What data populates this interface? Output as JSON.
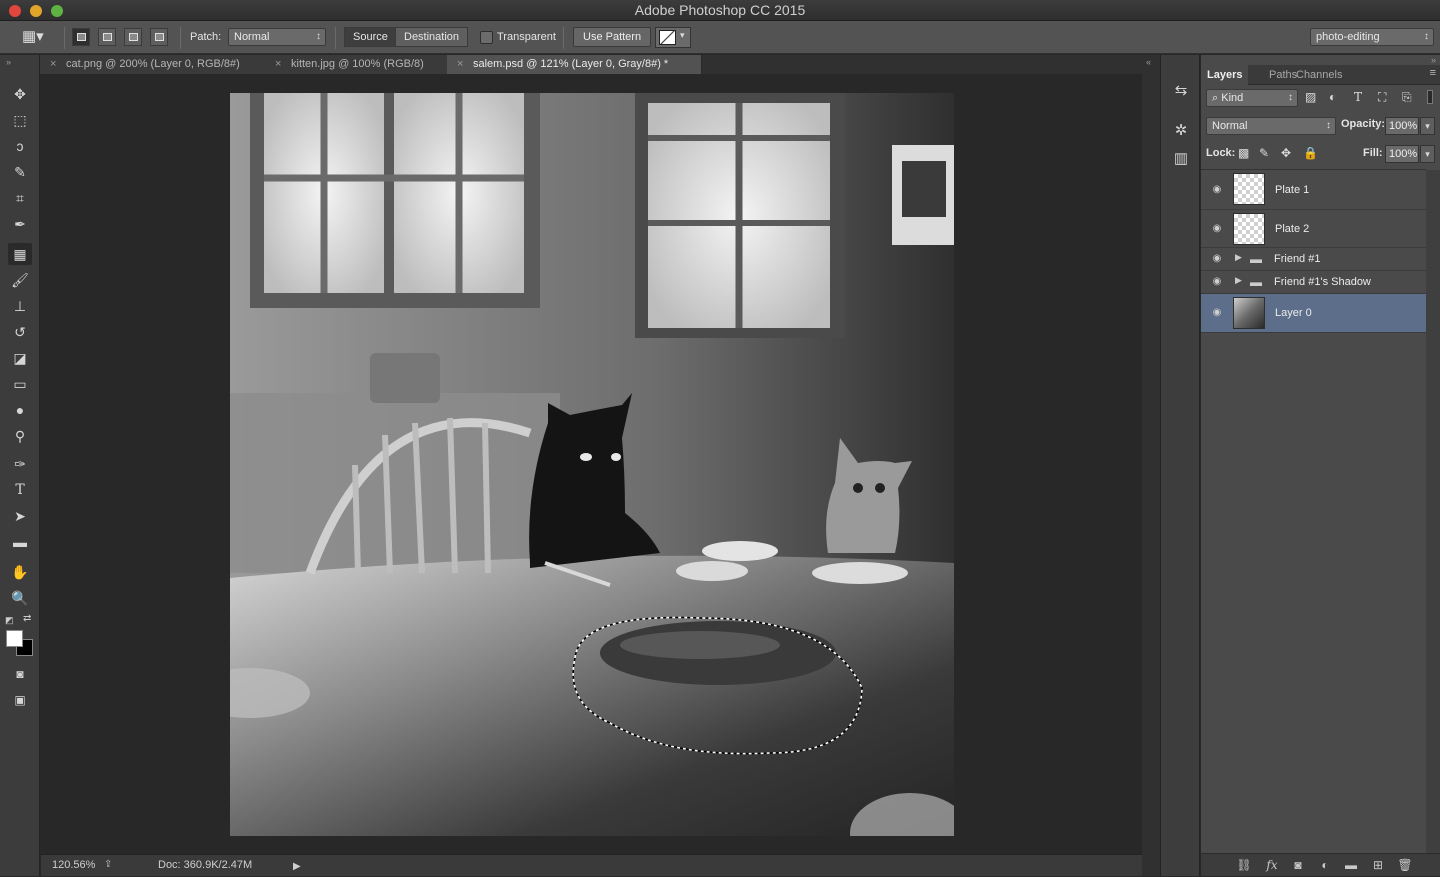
{
  "window": {
    "title": "Adobe Photoshop CC 2015"
  },
  "options_bar": {
    "patch_label": "Patch:",
    "patch_mode": "Normal",
    "source_label": "Source",
    "destination_label": "Destination",
    "transparent_label": "Transparent",
    "use_pattern_label": "Use Pattern",
    "workspace": "photo-editing"
  },
  "doc_tabs": [
    {
      "label": "cat.png @ 200% (Layer 0, RGB/8#)",
      "active": false
    },
    {
      "label": "kitten.jpg @ 100% (RGB/8)",
      "active": false
    },
    {
      "label": "salem.psd @ 121% (Layer 0, Gray/8#) *",
      "active": true
    }
  ],
  "tools": [
    "move-tool",
    "marquee-tool",
    "lasso-tool",
    "quick-selection-tool",
    "crop-tool",
    "eyedropper-tool",
    "patch-tool",
    "brush-tool",
    "clone-stamp-tool",
    "history-brush-tool",
    "eraser-tool",
    "gradient-tool",
    "blur-tool",
    "dodge-tool",
    "pen-tool",
    "type-tool",
    "path-selection-tool",
    "rectangle-tool",
    "hand-tool",
    "zoom-tool"
  ],
  "status": {
    "zoom": "120.56%",
    "doc_info": "Doc: 360.9K/2.47M"
  },
  "layers_panel": {
    "tabs": [
      "Layers",
      "Paths",
      "Channels"
    ],
    "filter_kind": "Kind",
    "blend_mode": "Normal",
    "opacity_label": "Opacity:",
    "opacity_value": "100%",
    "lock_label": "Lock:",
    "fill_label": "Fill:",
    "fill_value": "100%",
    "layers": [
      {
        "name": "Plate 1",
        "type": "layer",
        "selected": false
      },
      {
        "name": "Plate 2",
        "type": "layer",
        "selected": false
      },
      {
        "name": "Friend #1",
        "type": "group",
        "selected": false
      },
      {
        "name": "Friend #1's Shadow",
        "type": "group",
        "selected": false
      },
      {
        "name": "Layer 0",
        "type": "layer",
        "selected": true
      }
    ]
  },
  "colors": {
    "selected_layer": "#5c6e8a",
    "panel_bg": "#4a4a4a",
    "canvas_bg": "#282828"
  }
}
